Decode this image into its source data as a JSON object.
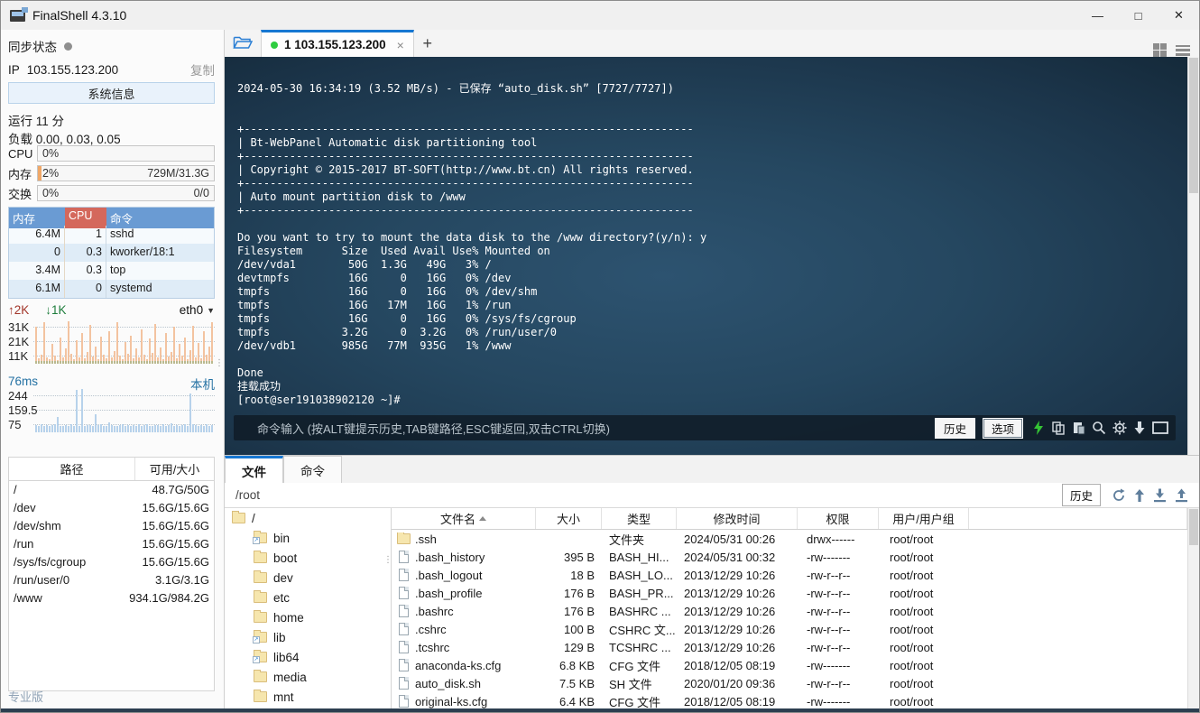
{
  "window": {
    "title": "FinalShell 4.3.10",
    "minimize": "—",
    "maximize": "□",
    "close": "✕"
  },
  "icons": {
    "up": "↑",
    "down": "↓",
    "dropdown": "▼",
    "splitter": "⋮",
    "symlink": "↗"
  },
  "sidebar": {
    "sync_label": "同步状态",
    "ip_label": "IP",
    "ip": "103.155.123.200",
    "copy_label": "复制",
    "sysinfo_button": "系统信息",
    "uptime": "运行 11 分",
    "load": "负载 0.00, 0.03, 0.05",
    "gauges": [
      {
        "label": "CPU",
        "left": "0%",
        "right": "",
        "fill": 0
      },
      {
        "label": "内存",
        "left": "2%",
        "right": "729M/31.3G",
        "fill": 2
      },
      {
        "label": "交换",
        "left": "0%",
        "right": "0/0",
        "fill": 0
      }
    ],
    "process_table": {
      "headers": [
        "内存",
        "CPU",
        "命令"
      ],
      "rows": [
        [
          "6.4M",
          "1",
          "sshd"
        ],
        [
          "0",
          "0.3",
          "kworker/18:1"
        ],
        [
          "3.4M",
          "0.3",
          "top"
        ],
        [
          "6.1M",
          "0",
          "systemd"
        ]
      ]
    },
    "network": {
      "up": "2K",
      "down": "1K",
      "iface": "eth0",
      "ticks": [
        "31K",
        "21K",
        "11K"
      ],
      "bars": [
        85,
        12,
        20,
        95,
        15,
        10,
        45,
        18,
        8,
        60,
        14,
        35,
        98,
        22,
        10,
        55,
        15,
        70,
        12,
        28,
        90,
        16,
        40,
        10,
        62,
        20,
        12,
        75,
        14,
        30,
        95,
        18,
        10,
        50,
        22,
        65,
        12,
        35,
        15,
        80,
        20,
        10,
        58,
        25,
        92,
        14,
        38,
        10,
        70,
        16,
        28,
        85,
        12,
        45,
        18,
        60,
        10,
        32,
        88,
        15,
        48,
        12,
        75,
        20,
        40,
        95
      ]
    },
    "ping": {
      "latency": "76ms",
      "host": "本机",
      "ticks": [
        "244",
        "159.5",
        "75"
      ],
      "bars": [
        16,
        14,
        18,
        15,
        17,
        14,
        16,
        19,
        35,
        15,
        14,
        16,
        15,
        18,
        14,
        98,
        15,
        100,
        14,
        17,
        16,
        15,
        42,
        16,
        18,
        14,
        15,
        22,
        17,
        15,
        14,
        16,
        18,
        15,
        16,
        14,
        17,
        15,
        19,
        14,
        16,
        18,
        15,
        14,
        17,
        16,
        15,
        18,
        14,
        16,
        20,
        15,
        17,
        14,
        16,
        18,
        15,
        90,
        19,
        16,
        15,
        17,
        14,
        18,
        15,
        16
      ]
    },
    "disk_table": {
      "headers": [
        "路径",
        "可用/大小"
      ],
      "rows": [
        [
          "/",
          "48.7G/50G"
        ],
        [
          "/dev",
          "15.6G/15.6G"
        ],
        [
          "/dev/shm",
          "15.6G/15.6G"
        ],
        [
          "/run",
          "15.6G/15.6G"
        ],
        [
          "/sys/fs/cgroup",
          "15.6G/15.6G"
        ],
        [
          "/run/user/0",
          "3.1G/3.1G"
        ],
        [
          "/www",
          "934.1G/984.2G"
        ]
      ]
    },
    "edition": "专业版"
  },
  "terminal": {
    "tab": {
      "label": "1 103.155.123.200",
      "close": "×",
      "new_tab": "+"
    },
    "lines": [
      "2024-05-30 16:34:19 (3.52 MB/s) - 已保存 “auto_disk.sh” [7727/7727])",
      "",
      "",
      "+---------------------------------------------------------------------",
      "| Bt-WebPanel Automatic disk partitioning tool",
      "+---------------------------------------------------------------------",
      "| Copyright © 2015-2017 BT-SOFT(http://www.bt.cn) All rights reserved.",
      "+---------------------------------------------------------------------",
      "| Auto mount partition disk to /www",
      "+---------------------------------------------------------------------",
      "",
      "Do you want to try to mount the data disk to the /www directory?(y/n): y",
      "Filesystem      Size  Used Avail Use% Mounted on",
      "/dev/vda1        50G  1.3G   49G   3% /",
      "devtmpfs         16G     0   16G   0% /dev",
      "tmpfs            16G     0   16G   0% /dev/shm",
      "tmpfs            16G   17M   16G   1% /run",
      "tmpfs            16G     0   16G   0% /sys/fs/cgroup",
      "tmpfs           3.2G     0  3.2G   0% /run/user/0",
      "/dev/vdb1       985G   77M  935G   1% /www",
      "",
      "Done",
      "挂载成功",
      "[root@ser191038902120 ~]#"
    ],
    "cmdbar": {
      "placeholder": "命令输入 (按ALT键提示历史,TAB键路径,ESC键返回,双击CTRL切换)",
      "history": "历史",
      "options": "选项"
    }
  },
  "bottom": {
    "tabs": [
      {
        "label": "文件",
        "active": true
      },
      {
        "label": "命令",
        "active": false
      }
    ],
    "path": "/root",
    "history_button": "历史",
    "tree": {
      "root": "/",
      "items": [
        {
          "name": "bin",
          "link": true
        },
        {
          "name": "boot",
          "link": false
        },
        {
          "name": "dev",
          "link": false
        },
        {
          "name": "etc",
          "link": false
        },
        {
          "name": "home",
          "link": false
        },
        {
          "name": "lib",
          "link": true
        },
        {
          "name": "lib64",
          "link": true
        },
        {
          "name": "media",
          "link": false
        },
        {
          "name": "mnt",
          "link": false
        }
      ]
    },
    "file_table": {
      "headers": [
        "文件名",
        "大小",
        "类型",
        "修改时间",
        "权限",
        "用户/用户组"
      ],
      "rows": [
        {
          "icon": "folder",
          "name": ".ssh",
          "size": "",
          "type": "文件夹",
          "mtime": "2024/05/31 00:26",
          "perm": "drwx------",
          "owner": "root/root"
        },
        {
          "icon": "file",
          "name": ".bash_history",
          "size": "395 B",
          "type": "BASH_HI...",
          "mtime": "2024/05/31 00:32",
          "perm": "-rw-------",
          "owner": "root/root"
        },
        {
          "icon": "file",
          "name": ".bash_logout",
          "size": "18 B",
          "type": "BASH_LO...",
          "mtime": "2013/12/29 10:26",
          "perm": "-rw-r--r--",
          "owner": "root/root"
        },
        {
          "icon": "file",
          "name": ".bash_profile",
          "size": "176 B",
          "type": "BASH_PR...",
          "mtime": "2013/12/29 10:26",
          "perm": "-rw-r--r--",
          "owner": "root/root"
        },
        {
          "icon": "file",
          "name": ".bashrc",
          "size": "176 B",
          "type": "BASHRC ...",
          "mtime": "2013/12/29 10:26",
          "perm": "-rw-r--r--",
          "owner": "root/root"
        },
        {
          "icon": "file",
          "name": ".cshrc",
          "size": "100 B",
          "type": "CSHRC 文...",
          "mtime": "2013/12/29 10:26",
          "perm": "-rw-r--r--",
          "owner": "root/root"
        },
        {
          "icon": "file",
          "name": ".tcshrc",
          "size": "129 B",
          "type": "TCSHRC ...",
          "mtime": "2013/12/29 10:26",
          "perm": "-rw-r--r--",
          "owner": "root/root"
        },
        {
          "icon": "file",
          "name": "anaconda-ks.cfg",
          "size": "6.8 KB",
          "type": "CFG 文件",
          "mtime": "2018/12/05 08:19",
          "perm": "-rw-------",
          "owner": "root/root"
        },
        {
          "icon": "file",
          "name": "auto_disk.sh",
          "size": "7.5 KB",
          "type": "SH 文件",
          "mtime": "2020/01/20 09:36",
          "perm": "-rw-r--r--",
          "owner": "root/root"
        },
        {
          "icon": "file",
          "name": "original-ks.cfg",
          "size": "6.4 KB",
          "type": "CFG 文件",
          "mtime": "2018/12/05 08:19",
          "perm": "-rw-------",
          "owner": "root/root"
        }
      ]
    }
  },
  "colors": {
    "accent": "#1677d2",
    "proc_header_blue": "#6a9bd3",
    "proc_header_red": "#d4685c",
    "net_bar": "#f3c3a0",
    "ping_bar": "#b7d2eb",
    "lightning": "#35c435"
  }
}
